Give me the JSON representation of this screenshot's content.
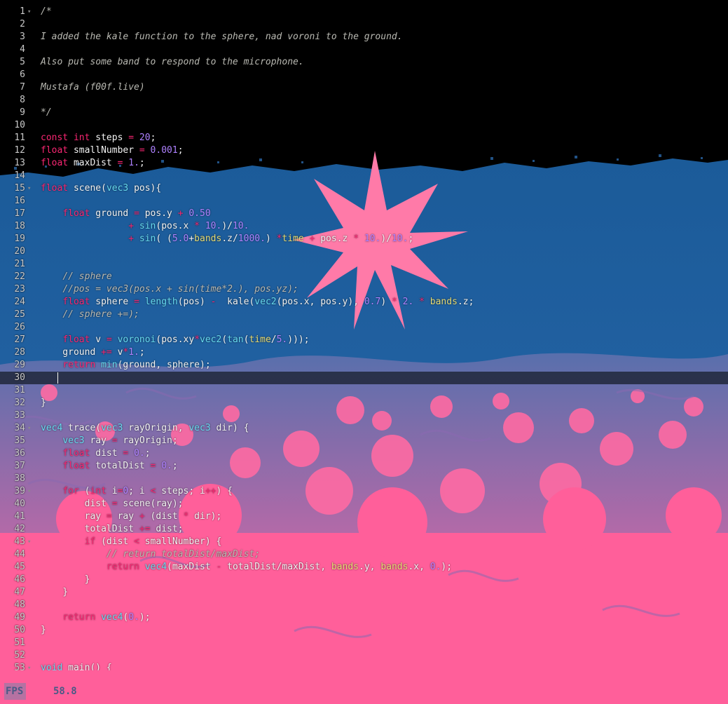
{
  "editor": {
    "active_line": 30,
    "lines": [
      {
        "num": "1",
        "fold": true,
        "tokens": [
          [
            "/*",
            "comment"
          ]
        ]
      },
      {
        "num": "2",
        "tokens": []
      },
      {
        "num": "3",
        "tokens": [
          [
            "I added the kale function to the sphere, nad voroni to the ground.",
            "comment"
          ]
        ]
      },
      {
        "num": "4",
        "tokens": []
      },
      {
        "num": "5",
        "tokens": [
          [
            "Also put some band to respond to the microphone.",
            "comment"
          ]
        ]
      },
      {
        "num": "6",
        "tokens": []
      },
      {
        "num": "7",
        "tokens": [
          [
            "Mustafa (f00f.live)",
            "comment"
          ]
        ]
      },
      {
        "num": "8",
        "tokens": []
      },
      {
        "num": "9",
        "tokens": [
          [
            "*/",
            "comment"
          ]
        ]
      },
      {
        "num": "10",
        "tokens": []
      },
      {
        "num": "11",
        "tokens": [
          [
            "const",
            "keyword"
          ],
          [
            " ",
            ""
          ],
          [
            "int",
            "keyword"
          ],
          [
            " steps ",
            ""
          ],
          [
            "=",
            "op"
          ],
          [
            " ",
            ""
          ],
          [
            "20",
            "number"
          ],
          [
            ";",
            ""
          ]
        ]
      },
      {
        "num": "12",
        "tokens": [
          [
            "float",
            "keyword"
          ],
          [
            " smallNumber ",
            ""
          ],
          [
            "=",
            "op"
          ],
          [
            " ",
            ""
          ],
          [
            "0.001",
            "number"
          ],
          [
            ";",
            ""
          ]
        ]
      },
      {
        "num": "13",
        "tokens": [
          [
            "float",
            "keyword"
          ],
          [
            " maxDist ",
            ""
          ],
          [
            "=",
            "op"
          ],
          [
            " ",
            ""
          ],
          [
            "1.",
            "number"
          ],
          [
            ";",
            ""
          ]
        ]
      },
      {
        "num": "14",
        "tokens": []
      },
      {
        "num": "15",
        "fold": true,
        "tokens": [
          [
            "float",
            "keyword"
          ],
          [
            " scene(",
            ""
          ],
          [
            "vec3",
            "type"
          ],
          [
            " pos){",
            ""
          ]
        ]
      },
      {
        "num": "16",
        "tokens": []
      },
      {
        "num": "17",
        "tokens": [
          [
            "    ",
            ""
          ],
          [
            "float",
            "keyword"
          ],
          [
            " ground ",
            ""
          ],
          [
            "=",
            "op"
          ],
          [
            " pos.y ",
            ""
          ],
          [
            "+",
            "op"
          ],
          [
            " ",
            ""
          ],
          [
            "0.50",
            "number"
          ]
        ]
      },
      {
        "num": "18",
        "tokens": [
          [
            "                ",
            ""
          ],
          [
            "+",
            "op"
          ],
          [
            " ",
            ""
          ],
          [
            "sin",
            "type"
          ],
          [
            "(pos.x ",
            ""
          ],
          [
            "*",
            "op"
          ],
          [
            " ",
            ""
          ],
          [
            "10.",
            "number"
          ],
          [
            ")/",
            ""
          ],
          [
            "10.",
            "number"
          ]
        ]
      },
      {
        "num": "19",
        "tokens": [
          [
            "                ",
            ""
          ],
          [
            "+",
            "op"
          ],
          [
            " ",
            ""
          ],
          [
            "sin",
            "type"
          ],
          [
            "( (",
            ""
          ],
          [
            "5.0",
            "number"
          ],
          [
            "+",
            ""
          ],
          [
            "bands",
            "builtin"
          ],
          [
            ".z/",
            ""
          ],
          [
            "1000.",
            "number"
          ],
          [
            ") ",
            ""
          ],
          [
            "*",
            "op"
          ],
          [
            "time",
            "builtin"
          ],
          [
            " ",
            ""
          ],
          [
            "+",
            "op"
          ],
          [
            " pos.z ",
            ""
          ],
          [
            "*",
            "op"
          ],
          [
            " ",
            ""
          ],
          [
            "10.",
            "number"
          ],
          [
            ")/",
            ""
          ],
          [
            "10.",
            "number"
          ],
          [
            ";",
            ""
          ]
        ]
      },
      {
        "num": "20",
        "tokens": []
      },
      {
        "num": "21",
        "tokens": []
      },
      {
        "num": "22",
        "tokens": [
          [
            "    ",
            ""
          ],
          [
            "// sphere",
            "comment"
          ]
        ]
      },
      {
        "num": "23",
        "tokens": [
          [
            "    ",
            ""
          ],
          [
            "//pos = vec3(pos.x + sin(time*2.), pos.yz);",
            "comment"
          ]
        ]
      },
      {
        "num": "24",
        "tokens": [
          [
            "    ",
            ""
          ],
          [
            "float",
            "keyword"
          ],
          [
            " sphere ",
            ""
          ],
          [
            "=",
            "op"
          ],
          [
            " ",
            ""
          ],
          [
            "length",
            "type"
          ],
          [
            "(pos) ",
            ""
          ],
          [
            "-",
            "op"
          ],
          [
            "  kale(",
            ""
          ],
          [
            "vec2",
            "type"
          ],
          [
            "(pos.x, pos.y), ",
            ""
          ],
          [
            "0.7",
            "number"
          ],
          [
            ") ",
            ""
          ],
          [
            "*",
            "op"
          ],
          [
            " ",
            ""
          ],
          [
            "2.",
            "number"
          ],
          [
            " ",
            ""
          ],
          [
            "*",
            "op"
          ],
          [
            " ",
            ""
          ],
          [
            "bands",
            "builtin"
          ],
          [
            ".z;",
            ""
          ]
        ]
      },
      {
        "num": "25",
        "tokens": [
          [
            "    ",
            ""
          ],
          [
            "// sphere +=);",
            "comment"
          ]
        ]
      },
      {
        "num": "26",
        "tokens": []
      },
      {
        "num": "27",
        "tokens": [
          [
            "    ",
            ""
          ],
          [
            "float",
            "keyword"
          ],
          [
            " v ",
            ""
          ],
          [
            "=",
            "op"
          ],
          [
            " ",
            ""
          ],
          [
            "voronoi",
            "type"
          ],
          [
            "(pos.xy",
            ""
          ],
          [
            "*",
            "op"
          ],
          [
            "vec2",
            "type"
          ],
          [
            "(",
            ""
          ],
          [
            "tan",
            "type"
          ],
          [
            "(",
            ""
          ],
          [
            "time",
            "builtin"
          ],
          [
            "/",
            ""
          ],
          [
            "5.",
            "number"
          ],
          [
            ")));",
            ""
          ]
        ]
      },
      {
        "num": "28",
        "tokens": [
          [
            "    ground ",
            ""
          ],
          [
            "+=",
            "op"
          ],
          [
            " v",
            ""
          ],
          [
            "*",
            "op"
          ],
          [
            "1.",
            "number"
          ],
          [
            ";",
            ""
          ]
        ]
      },
      {
        "num": "29",
        "tokens": [
          [
            "    ",
            ""
          ],
          [
            "return",
            "keyword"
          ],
          [
            " ",
            ""
          ],
          [
            "min",
            "type"
          ],
          [
            "(ground, sphere);",
            ""
          ]
        ]
      },
      {
        "num": "30",
        "tokens": []
      },
      {
        "num": "31",
        "tokens": []
      },
      {
        "num": "32",
        "tokens": [
          [
            "}",
            ""
          ]
        ]
      },
      {
        "num": "33",
        "tokens": []
      },
      {
        "num": "34",
        "fold": true,
        "tokens": [
          [
            "vec4",
            "type"
          ],
          [
            " trace(",
            ""
          ],
          [
            "vec3",
            "type"
          ],
          [
            " rayOrigin, ",
            ""
          ],
          [
            "vec3",
            "type"
          ],
          [
            " dir) {",
            ""
          ]
        ]
      },
      {
        "num": "35",
        "tokens": [
          [
            "    ",
            ""
          ],
          [
            "vec3",
            "type"
          ],
          [
            " ray ",
            ""
          ],
          [
            "=",
            "op"
          ],
          [
            " rayOrigin;",
            ""
          ]
        ]
      },
      {
        "num": "36",
        "tokens": [
          [
            "    ",
            ""
          ],
          [
            "float",
            "keyword"
          ],
          [
            " dist ",
            ""
          ],
          [
            "=",
            "op"
          ],
          [
            " ",
            ""
          ],
          [
            "0.",
            "number"
          ],
          [
            ";",
            ""
          ]
        ]
      },
      {
        "num": "37",
        "tokens": [
          [
            "    ",
            ""
          ],
          [
            "float",
            "keyword"
          ],
          [
            " totalDist ",
            ""
          ],
          [
            "=",
            "op"
          ],
          [
            " ",
            ""
          ],
          [
            "0.",
            "number"
          ],
          [
            ";",
            ""
          ]
        ]
      },
      {
        "num": "38",
        "tokens": []
      },
      {
        "num": "39",
        "fold": true,
        "tokens": [
          [
            "    ",
            ""
          ],
          [
            "for",
            "keyword"
          ],
          [
            " (",
            ""
          ],
          [
            "int",
            "keyword"
          ],
          [
            " i",
            ""
          ],
          [
            "=",
            "op"
          ],
          [
            "0",
            "number"
          ],
          [
            "; i ",
            ""
          ],
          [
            "<",
            "op"
          ],
          [
            " steps; i",
            ""
          ],
          [
            "++",
            "op"
          ],
          [
            ") {",
            ""
          ]
        ]
      },
      {
        "num": "40",
        "tokens": [
          [
            "        dist ",
            ""
          ],
          [
            "=",
            "op"
          ],
          [
            " scene(ray);",
            ""
          ]
        ]
      },
      {
        "num": "41",
        "tokens": [
          [
            "        ray ",
            ""
          ],
          [
            "=",
            "op"
          ],
          [
            " ray ",
            ""
          ],
          [
            "+",
            "op"
          ],
          [
            " (dist ",
            ""
          ],
          [
            "*",
            "op"
          ],
          [
            " dir);",
            ""
          ]
        ]
      },
      {
        "num": "42",
        "tokens": [
          [
            "        totalDist ",
            ""
          ],
          [
            "+=",
            "op"
          ],
          [
            " dist;",
            ""
          ]
        ]
      },
      {
        "num": "43",
        "fold": true,
        "tokens": [
          [
            "        ",
            ""
          ],
          [
            "if",
            "keyword"
          ],
          [
            " (dist ",
            ""
          ],
          [
            "<",
            "op"
          ],
          [
            " smallNumber) {",
            ""
          ]
        ]
      },
      {
        "num": "44",
        "tokens": [
          [
            "            ",
            ""
          ],
          [
            "// return totalDist/maxDist;",
            "comment"
          ]
        ]
      },
      {
        "num": "45",
        "tokens": [
          [
            "            ",
            ""
          ],
          [
            "return",
            "keyword"
          ],
          [
            " ",
            ""
          ],
          [
            "vec4",
            "type"
          ],
          [
            "(maxDist ",
            ""
          ],
          [
            "-",
            "op"
          ],
          [
            " totalDist/maxDist, ",
            ""
          ],
          [
            "bands",
            "builtin"
          ],
          [
            ".y, ",
            ""
          ],
          [
            "bands",
            "builtin"
          ],
          [
            ".x, ",
            ""
          ],
          [
            "0.",
            "number"
          ],
          [
            ");",
            ""
          ]
        ]
      },
      {
        "num": "46",
        "tokens": [
          [
            "        }",
            ""
          ]
        ]
      },
      {
        "num": "47",
        "tokens": [
          [
            "    }",
            ""
          ]
        ]
      },
      {
        "num": "48",
        "tokens": []
      },
      {
        "num": "49",
        "tokens": [
          [
            "    ",
            ""
          ],
          [
            "return",
            "keyword"
          ],
          [
            " ",
            ""
          ],
          [
            "vec4",
            "type"
          ],
          [
            "(",
            ""
          ],
          [
            "0.",
            "number"
          ],
          [
            ");",
            ""
          ]
        ]
      },
      {
        "num": "50",
        "tokens": [
          [
            "}",
            ""
          ]
        ]
      },
      {
        "num": "51",
        "tokens": []
      },
      {
        "num": "52",
        "tokens": []
      },
      {
        "num": "53",
        "fold": true,
        "tokens": [
          [
            "void",
            "type"
          ],
          [
            " main() {",
            ""
          ]
        ]
      }
    ]
  },
  "fps": {
    "label": "FPS",
    "value": "58.8",
    "level": 0.28
  },
  "colors": {
    "pink": "#ff5f9a",
    "blue": "#1f5f9e",
    "black": "#000000",
    "star": "#ff7aa8"
  }
}
